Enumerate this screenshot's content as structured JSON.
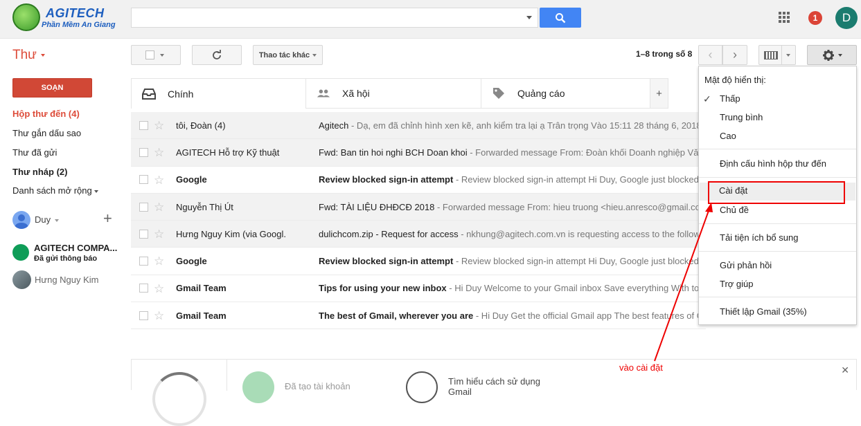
{
  "header": {
    "logo_title": "AGITECH",
    "logo_subtitle": "Phần Mềm An Giang",
    "logo_badge": "AGITECH",
    "search_placeholder": "",
    "notification_count": "1",
    "avatar_letter": "D",
    "accent_color": "#4285f4"
  },
  "toolbar": {
    "mail_label": "Thư",
    "more_actions": "Thao tác khác",
    "page_count": "1–8 trong số 8"
  },
  "sidebar": {
    "compose": "SOẠN",
    "items": [
      {
        "label": "Hộp thư đến (4)"
      },
      {
        "label": "Thư gắn dấu sao"
      },
      {
        "label": "Thư đã gửi"
      },
      {
        "label": "Thư nháp (2)"
      },
      {
        "label": "Danh sách mở rộng"
      }
    ],
    "hangout_user": "Duy",
    "chats": [
      {
        "name": "AGITECH COMPA...",
        "status": "Đã gửi thông báo"
      },
      {
        "name": "Hưng Nguy Kim",
        "status": ""
      }
    ]
  },
  "tabs": [
    {
      "label": "Chính",
      "icon": "inbox-icon"
    },
    {
      "label": "Xã hội",
      "icon": "people-icon"
    },
    {
      "label": "Quảng cáo",
      "icon": "tag-icon"
    }
  ],
  "emails": [
    {
      "from": "tôi, Đoàn (4)",
      "subject": "Agitech",
      "snippet": " - Dạ, em đã chỉnh hình xen kẽ, anh kiểm tra lại ạ Trân trọng Vào 15:11 28 tháng 6, 2018",
      "unread": false
    },
    {
      "from": "AGITECH Hỗ trợ Kỹ thuật",
      "subject": "Fwd: Ban tin hoi nghi BCH Doan khoi",
      "snippet": " - Forwarded message From: Đoàn khối Doanh nghiệp Văn",
      "unread": false
    },
    {
      "from": "Google",
      "subject": "Review blocked sign-in attempt",
      "snippet": " - Review blocked sign-in attempt Hi Duy, Google just blocked s",
      "unread": true
    },
    {
      "from": "Nguyễn Thị Út",
      "subject": "Fwd: TÀI LIỆU ĐHĐCĐ 2018",
      "snippet": " - Forwarded message From: hieu truong <hieu.anresco@gmail.co",
      "unread": false
    },
    {
      "from": "Hưng Nguy Kim (via Googl.",
      "subject": "dulichcom.zip - Request for access",
      "snippet": " - nkhung@agitech.com.vn is requesting access to the followi",
      "unread": false
    },
    {
      "from": "Google",
      "subject": "Review blocked sign-in attempt",
      "snippet": " - Review blocked sign-in attempt Hi Duy, Google just blocked s",
      "unread": true
    },
    {
      "from": "Gmail Team",
      "subject": "Tips for using your new inbox",
      "snippet": " - Hi Duy Welcome to your Gmail inbox Save everything With ton",
      "unread": true
    },
    {
      "from": "Gmail Team",
      "subject": "The best of Gmail, wherever you are",
      "snippet": " - Hi Duy Get the official Gmail app The best features of G",
      "unread": true
    }
  ],
  "setup": {
    "step1": "Đã tạo tài khoản",
    "step2": "Tìm hiểu cách sử dụng",
    "step2_cont": "Gmail"
  },
  "settings_menu": {
    "header": "Mật độ hiển thị:",
    "density": [
      "Thấp",
      "Trung bình",
      "Cao"
    ],
    "configure_inbox": "Định cấu hình hộp thư đến",
    "settings": "Cài đặt",
    "themes": "Chủ đề",
    "addons": "Tải tiện ích bổ sung",
    "feedback": "Gửi phản hồi",
    "help": "Trợ giúp",
    "setup_progress": "Thiết lập Gmail (35%)"
  },
  "annotation": {
    "note": "vào cài đặt",
    "color": "#ee0000"
  }
}
